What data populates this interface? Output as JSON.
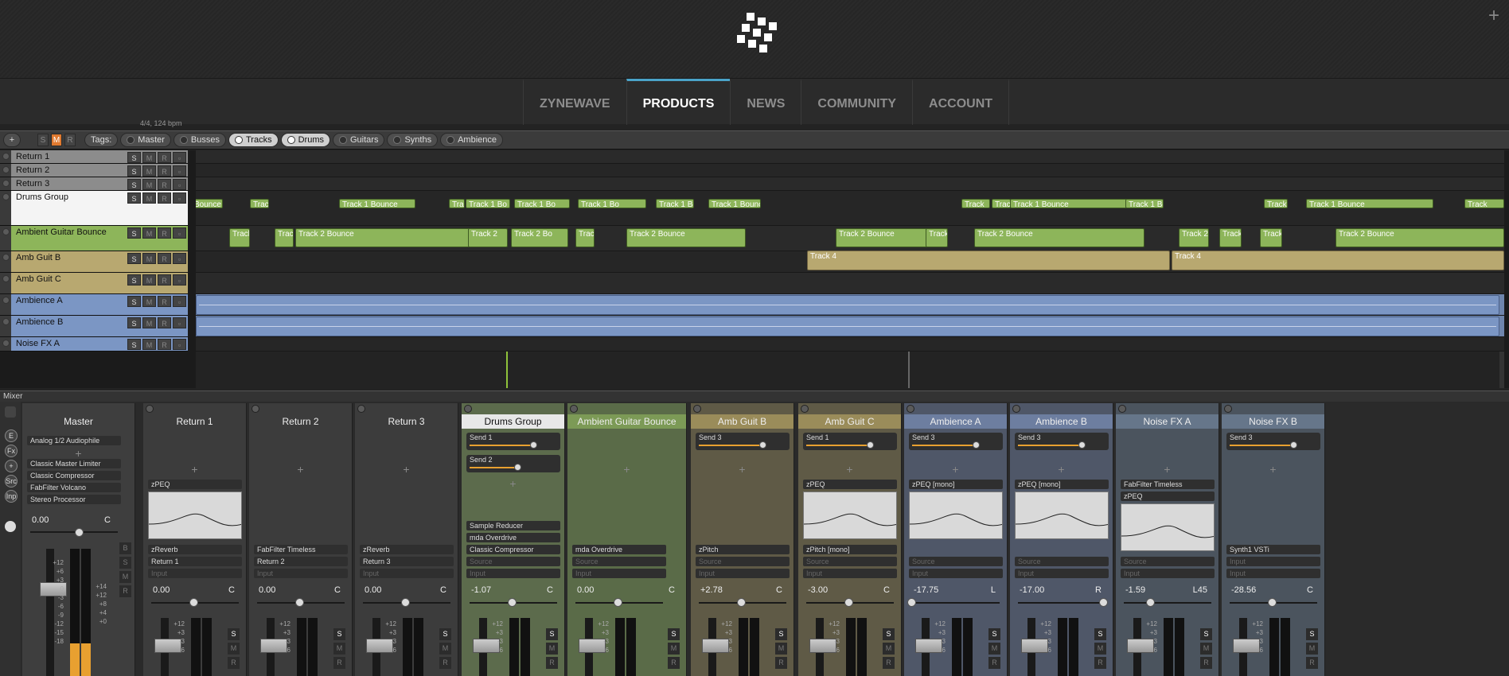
{
  "nav": {
    "items": [
      "ZYNEWAVE",
      "PRODUCTS",
      "NEWS",
      "COMMUNITY",
      "ACCOUNT"
    ],
    "active_index": 1
  },
  "icons": {
    "logo": "dotted-square-logo",
    "corner": "plus-icon"
  },
  "toolbar": {
    "add_label": "+",
    "s_label": "S",
    "m_label": "M",
    "r_label": "R",
    "tags_label": "Tags:",
    "tags": [
      {
        "label": "Master",
        "on": false
      },
      {
        "label": "Busses",
        "on": false
      },
      {
        "label": "Tracks",
        "on": true
      },
      {
        "label": "Drums",
        "on": true
      },
      {
        "label": "Guitars",
        "on": false
      },
      {
        "label": "Synths",
        "on": false
      },
      {
        "label": "Ambience",
        "on": false
      }
    ],
    "timeline_hint": "4/4, 124 bpm"
  },
  "tracks": [
    {
      "name": "Return 1",
      "color": "#8c8c8c"
    },
    {
      "name": "Return 2",
      "color": "#8c8c8c"
    },
    {
      "name": "Return 3",
      "color": "#8c8c8c"
    },
    {
      "name": "Drums Group",
      "color": "#f4f4f4"
    },
    {
      "name": "Ambient Guitar Bounce",
      "color": "#8db55a"
    },
    {
      "name": "Amb Guit B",
      "color": "#b8a870"
    },
    {
      "name": "Amb Guit C",
      "color": "#b8a870"
    },
    {
      "name": "Ambience A",
      "color": "#7b96c4"
    },
    {
      "name": "Ambience B",
      "color": "#7b96c4"
    },
    {
      "name": "Noise FX A",
      "color": "#7b96c4"
    }
  ],
  "track_buttons": {
    "s": "S",
    "m": "M",
    "r": "R"
  },
  "clips": {
    "drums": [
      "Bounce",
      "Track",
      "Track 1 Bounce",
      "Track",
      "Track 1 Bo",
      "Track 1 Bo",
      "Track 1 Bo",
      "Track 1 Bo",
      "Track 1 Bounce",
      "Track",
      "Track",
      "Track 1 Bounce",
      "Track 1 Bounce",
      "Track",
      "Track 1 Bounce",
      "Track"
    ],
    "guitar": [
      "Track",
      "Track",
      "Track 2 Bounce",
      "Track 2",
      "Track 2 Bo",
      "Track",
      "Track 2 Bounce",
      "Track 2 Bounce",
      "Track",
      "Track 2 Bounce",
      "Track 2",
      "Track",
      "Track",
      "Track 2 Bounce"
    ],
    "amb_c": [
      "Track 4",
      "Track 4"
    ]
  },
  "mixer": {
    "title": "Mixer",
    "side_buttons": [
      "E",
      "Fx",
      "+",
      "Src",
      "Inp"
    ],
    "master": {
      "name": "Master",
      "preset": "Analog 1/2 Audiophile",
      "fx": [
        "Classic Master Limiter",
        "Classic Compressor",
        "FabFilter Volcano",
        "Stereo Processor"
      ],
      "value": "0.00",
      "pan": "C",
      "scale": [
        "+12",
        "+6",
        "+3",
        "0",
        "-3",
        "-6",
        "-9",
        "-12",
        "-15",
        "-18"
      ],
      "scale2": [
        "+14",
        "+12",
        "+8",
        "+4",
        "+0"
      ],
      "side": [
        "B",
        "S",
        "M",
        "R"
      ]
    },
    "channels": [
      {
        "name": "Return 1",
        "sends": [],
        "fx_top": [
          "zPEQ"
        ],
        "fx": [
          "zReverb"
        ],
        "route": "Return 1",
        "value": "0.00",
        "pan": "C",
        "eq": true,
        "bg": "#3c3c3c",
        "hd": "#3c3c3c"
      },
      {
        "name": "Return 2",
        "sends": [],
        "fx_top": [],
        "fx": [
          "FabFilter Timeless"
        ],
        "route": "Return 2",
        "value": "0.00",
        "pan": "C",
        "eq": false,
        "bg": "#3c3c3c",
        "hd": "#3c3c3c"
      },
      {
        "name": "Return 3",
        "sends": [],
        "fx_top": [],
        "fx": [
          "zReverb"
        ],
        "route": "Return 3",
        "value": "0.00",
        "pan": "C",
        "eq": false,
        "bg": "#3c3c3c",
        "hd": "#3c3c3c"
      },
      {
        "name": "Drums Group",
        "sends": [
          "Send 1",
          "Send 2"
        ],
        "fx_top": [],
        "fx": [
          "Sample Reducer",
          "mda Overdrive",
          "Classic Compressor"
        ],
        "route": "Source",
        "value": "-1.07",
        "pan": "C",
        "eq": false,
        "bg": "#5c6b4c",
        "hd": "#e8e8e8"
      },
      {
        "name": "Ambient Guitar Bounce",
        "sends": [],
        "fx_top": [],
        "fx": [
          "mda Overdrive"
        ],
        "route": "Source",
        "value": "0.00",
        "pan": "C",
        "eq": false,
        "bg": "#5a6b48",
        "hd": "#7c9a56"
      },
      {
        "name": "Amb Guit B",
        "sends": [
          "Send 3"
        ],
        "fx_top": [],
        "fx": [
          "zPitch"
        ],
        "route": "Source",
        "value": "+2.78",
        "pan": "C",
        "eq": false,
        "bg": "#5f5a46",
        "hd": "#9a8c5a"
      },
      {
        "name": "Amb Guit C",
        "sends": [
          "Send 1"
        ],
        "fx_top": [
          "zPEQ"
        ],
        "fx": [
          "zPitch [mono]"
        ],
        "route": "Source",
        "value": "-3.00",
        "pan": "C",
        "eq": true,
        "bg": "#5f5a46",
        "hd": "#9a8c5a"
      },
      {
        "name": "Ambience A",
        "sends": [
          "Send 3"
        ],
        "fx_top": [
          "zPEQ [mono]"
        ],
        "fx": [],
        "route": "Source",
        "value": "-17.75",
        "pan": "L",
        "eq": true,
        "bg": "#4f5768",
        "hd": "#6d7ea0"
      },
      {
        "name": "Ambience B",
        "sends": [
          "Send 3"
        ],
        "fx_top": [
          "zPEQ [mono]"
        ],
        "fx": [],
        "route": "Source",
        "value": "-17.00",
        "pan": "R",
        "eq": true,
        "bg": "#4f5768",
        "hd": "#6d7ea0"
      },
      {
        "name": "Noise FX A",
        "sends": [],
        "fx_top": [
          "FabFilter Timeless",
          "zPEQ"
        ],
        "fx": [],
        "route": "Source",
        "value": "-1.59",
        "pan": "L45",
        "eq": true,
        "bg": "#4b545e",
        "hd": "#66768a"
      },
      {
        "name": "Noise FX B",
        "sends": [
          "Send 3"
        ],
        "fx_top": [],
        "fx": [
          "Synth1 VSTi"
        ],
        "route": "Input",
        "value": "-28.56",
        "pan": "C",
        "eq": false,
        "bg": "#4b545e",
        "hd": "#66768a"
      }
    ],
    "dim_labels": {
      "source": "Source",
      "input": "Input"
    },
    "ch_scale": [
      "+12",
      "+3",
      "-3",
      "-6"
    ],
    "ch_side": [
      "S",
      "M",
      "R"
    ],
    "edit_label": "E"
  }
}
